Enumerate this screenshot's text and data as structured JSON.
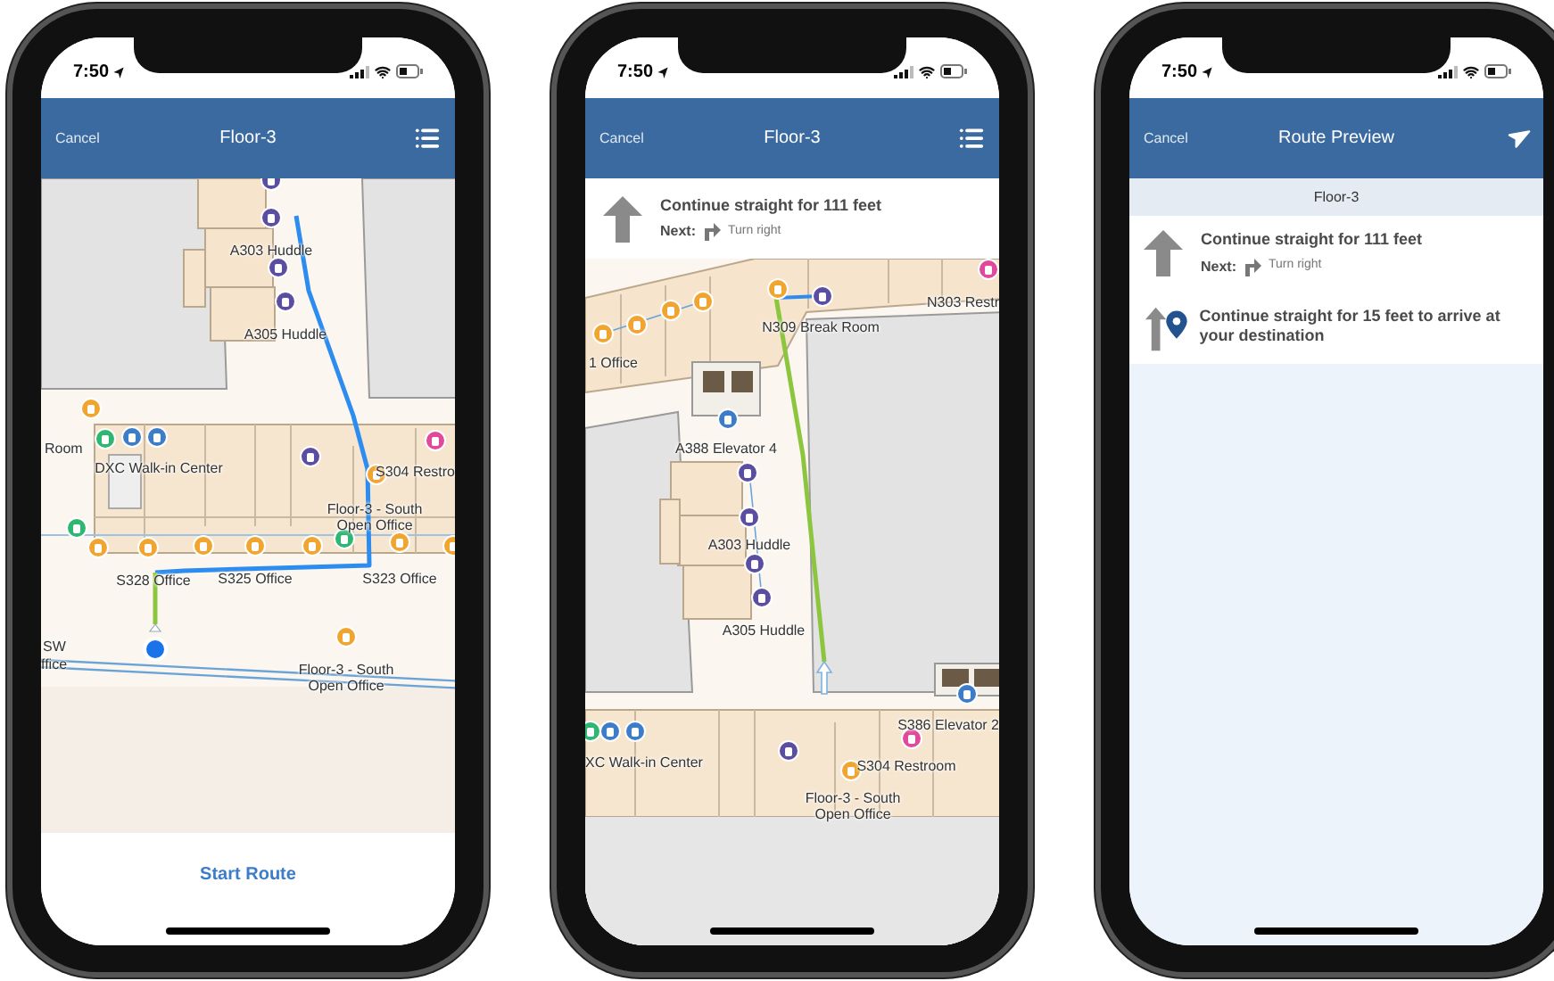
{
  "phones": [
    {
      "kind": "map",
      "time": "7:50",
      "header": {
        "cancel": "Cancel",
        "title": "Floor-3"
      },
      "map": {
        "labels": [
          "A303 Huddle",
          "A305 Huddle",
          "Room",
          "DXC Walk-in Center",
          "S304 Restro",
          "Floor-3 - South Open Office",
          "S328 Office",
          "S325 Office",
          "S323 Office",
          "SW",
          "ffice",
          "Floor-3 - South Open Office"
        ],
        "pins": [
          {
            "color": "#5b4ea0"
          },
          {
            "color": "#5b4ea0"
          },
          {
            "color": "#5b4ea0"
          },
          {
            "color": "#5b4ea0"
          },
          {
            "color": "#f0a530"
          },
          {
            "color": "#2fb673"
          },
          {
            "color": "#3d7dc8"
          },
          {
            "color": "#3d7dc8"
          },
          {
            "color": "#5b4ea0"
          },
          {
            "color": "#e04a9b"
          },
          {
            "color": "#f0a530"
          },
          {
            "color": "#2fb673"
          },
          {
            "color": "#f0a530"
          },
          {
            "color": "#f0a530"
          },
          {
            "color": "#f0a530"
          },
          {
            "color": "#f0a530"
          },
          {
            "color": "#f0a530"
          },
          {
            "color": "#2fb673"
          },
          {
            "color": "#f0a530"
          },
          {
            "color": "#f0a530"
          },
          {
            "color": "#f0a530"
          }
        ]
      },
      "start_button": "Start Route"
    },
    {
      "kind": "navigation",
      "time": "7:50",
      "header": {
        "cancel": "Cancel",
        "title": "Floor-3"
      },
      "instruction": {
        "text": "Continue straight for 111 feet",
        "next_label": "Next:",
        "next_text": "Turn right"
      },
      "map": {
        "labels": [
          "1 Office",
          "N309 Break Room",
          "N303 Restr",
          "A388 Elevator 4",
          "A303 Huddle",
          "A305 Huddle",
          "S386 Elevator 2",
          "XC Walk-in Center",
          "S304 Restroom",
          "Floor-3 - South Open Office"
        ],
        "pins": [
          {
            "color": "#f0a530"
          },
          {
            "color": "#f0a530"
          },
          {
            "color": "#f0a530"
          },
          {
            "color": "#f0a530"
          },
          {
            "color": "#f0a530"
          },
          {
            "color": "#5b4ea0"
          },
          {
            "color": "#e04a9b"
          },
          {
            "color": "#3d7dc8"
          },
          {
            "color": "#5b4ea0"
          },
          {
            "color": "#5b4ea0"
          },
          {
            "color": "#5b4ea0"
          },
          {
            "color": "#5b4ea0"
          },
          {
            "color": "#3d7dc8"
          },
          {
            "color": "#2fb673"
          },
          {
            "color": "#3d7dc8"
          },
          {
            "color": "#3d7dc8"
          },
          {
            "color": "#5b4ea0"
          },
          {
            "color": "#e04a9b"
          },
          {
            "color": "#f0a530"
          }
        ]
      }
    },
    {
      "kind": "preview",
      "time": "7:50",
      "header": {
        "cancel": "Cancel",
        "title": "Route Preview"
      },
      "section": "Floor-3",
      "steps": [
        {
          "kind": "continue",
          "text": "Continue straight for 111 feet",
          "next_label": "Next:",
          "next_text": "Turn right"
        },
        {
          "kind": "arrive",
          "text": "Continue straight for 15 feet to arrive at your destination"
        }
      ]
    }
  ]
}
